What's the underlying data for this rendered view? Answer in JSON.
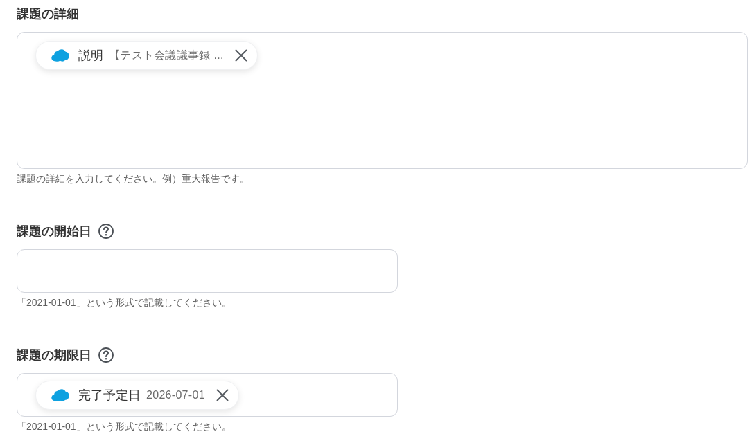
{
  "fields": [
    {
      "kind": "textarea",
      "label": "課題の詳細",
      "help_icon": false,
      "chips": [
        {
          "name": "説明",
          "value": "【テスト会議議事録 ..."
        }
      ],
      "hint": "課題の詳細を入力してください。例）重大報告です。"
    },
    {
      "kind": "input",
      "label": "課題の開始日",
      "help_icon": true,
      "hint": "「2021-01-01」という形式で記載してください。"
    },
    {
      "kind": "input",
      "label": "課題の期限日",
      "help_icon": true,
      "chips": [
        {
          "name": "完了予定日",
          "value": "2026-07-01"
        }
      ],
      "hint": "「2021-01-01」という形式で記載してください。"
    }
  ]
}
